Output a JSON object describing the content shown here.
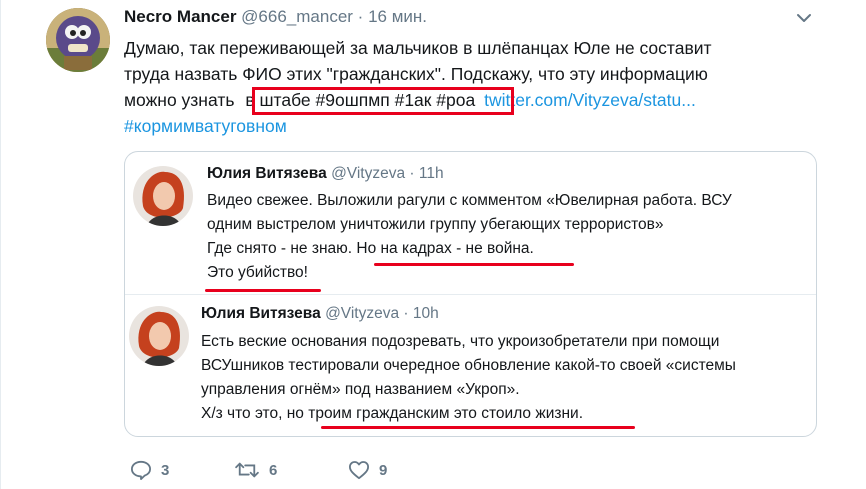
{
  "tweet": {
    "author_name": "Necro Mancer",
    "handle": "@666_mancer",
    "separator": "·",
    "time": "16 мин.",
    "lines": [
      "Думаю, так переживающей за мальчиков в шлёпанцах Юле не составит",
      "труда назвать ФИО этих \"гражданских\". Подскажу, что эту информацию",
      "можно узнать"
    ],
    "highlight_text": "в штабе #9ошпмп #1ак #роа",
    "link": "twitter.com/Vityzeva/statu...",
    "hashtag": "#кормимватуговном"
  },
  "quote": {
    "author_name": "Юлия Витязева",
    "handle": "@Vityzeva",
    "separator": "·",
    "time": "11h",
    "lines": [
      "Видео свежее. Выложили рагули с комментом «Ювелирная работа. ВСУ",
      "одним выстрелом уничтожили группу убегающих террористов»"
    ],
    "line3_prefix": "Где снято - не знаю.",
    "line3_underlined": "Но на кадрах - не война.",
    "line4_underlined": "Это убийство!"
  },
  "reply": {
    "author_name": "Юлия Витязева",
    "handle": "@Vityzeva",
    "separator": "·",
    "time": "10h",
    "lines": [
      "Есть веские основания подозревать, что укроизобретатели при помощи",
      "ВСУшников тестировали очередное обновление какой-то своей «системы",
      "управления огнём» под названием «Укроп»."
    ],
    "line4_prefix": "Х/з что это, но",
    "line4_underlined": "троим гражданским это стоило жизни."
  },
  "actions": {
    "reply_count": "3",
    "retweet_count": "6",
    "like_count": "9"
  },
  "colors": {
    "annotation_red": "#e8001d",
    "link_blue": "#1b95e0",
    "muted": "#657786"
  }
}
